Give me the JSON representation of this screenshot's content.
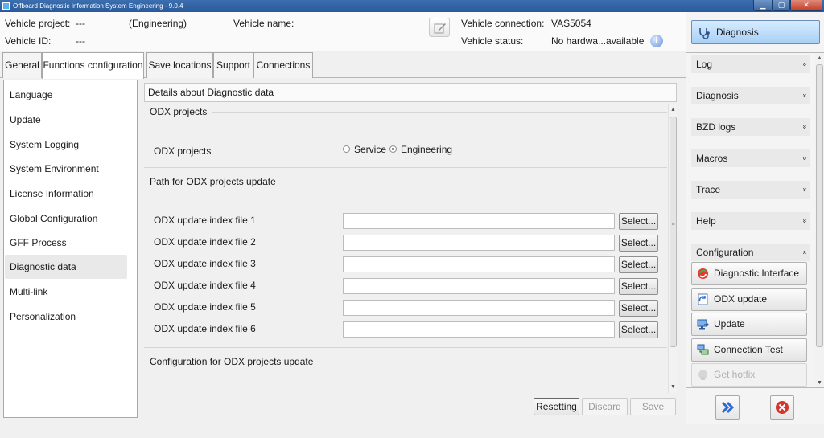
{
  "window": {
    "title": "Offboard Diagnostic Information System Engineering - 9.0.4",
    "min_glyph": "▁",
    "max_glyph": "▢",
    "close_glyph": "✕"
  },
  "header": {
    "vehicle_project_label": "Vehicle project:",
    "vehicle_project_value": "---",
    "project_type": "(Engineering)",
    "vehicle_name_label": "Vehicle name:",
    "vehicle_id_label": "Vehicle ID:",
    "vehicle_id_value": "---",
    "connection_label": "Vehicle connection:",
    "connection_value": "VAS5054",
    "status_label": "Vehicle status:",
    "status_value": "No hardwa...available",
    "info_glyph": "i"
  },
  "tabs": [
    "General",
    "Functions configuration",
    "Save locations",
    "Support",
    "Connections"
  ],
  "active_tab": "Functions configuration",
  "nav": {
    "items": [
      "Language",
      "Update",
      "System Logging",
      "System Environment",
      "License Information",
      "Global Configuration",
      "GFF Process",
      "Diagnostic data",
      "Multi-link",
      "Personalization"
    ],
    "selected": "Diagnostic data"
  },
  "content": {
    "caption": "Details about Diagnostic data",
    "odx_group_title": "ODX projects",
    "odx_field_label": "ODX projects",
    "radio_service": "Service",
    "radio_engineering": "Engineering",
    "radio_selected": "Engineering",
    "path_group_title": "Path for ODX projects update",
    "index_fields": [
      {
        "label": "ODX update index file 1",
        "value": ""
      },
      {
        "label": "ODX update index file 2",
        "value": ""
      },
      {
        "label": "ODX update index file 3",
        "value": ""
      },
      {
        "label": "ODX update index file 4",
        "value": ""
      },
      {
        "label": "ODX update index file 5",
        "value": ""
      },
      {
        "label": "ODX update index file 6",
        "value": ""
      }
    ],
    "select_label": "Select...",
    "config_group_title": "Configuration for ODX projects update",
    "scroll_up": "▲",
    "scroll_down": "▼"
  },
  "actions": {
    "resetting": "Resetting",
    "discard": "Discard",
    "save": "Save"
  },
  "right_panel": {
    "diagnosis_button": "Diagnosis",
    "sections": [
      {
        "label": "Log",
        "chevron": "»",
        "expanded": false
      },
      {
        "label": "Diagnosis",
        "chevron": "»",
        "expanded": false
      },
      {
        "label": "BZD logs",
        "chevron": "»",
        "expanded": false
      },
      {
        "label": "Macros",
        "chevron": "»",
        "expanded": false
      },
      {
        "label": "Trace",
        "chevron": "»",
        "expanded": false
      },
      {
        "label": "Help",
        "chevron": "»",
        "expanded": false
      },
      {
        "label": "Configuration",
        "chevron": "«",
        "expanded": true
      }
    ],
    "config_buttons": [
      {
        "label": "Diagnostic Interface",
        "icon": "diagnostic-interface-icon",
        "enabled": true
      },
      {
        "label": "ODX update",
        "icon": "odx-update-icon",
        "enabled": true
      },
      {
        "label": "Update",
        "icon": "update-icon",
        "enabled": true
      },
      {
        "label": "Connection Test",
        "icon": "connection-test-icon",
        "enabled": true
      },
      {
        "label": "Get hotfix",
        "icon": "get-hotfix-icon",
        "enabled": false
      }
    ],
    "scroll_up": "▲",
    "scroll_down": "▼"
  },
  "colors": {
    "titlebar": "#2a5a9a",
    "diagnosis_button": "#a9d0f5",
    "forward_icon": "#2d6bd0",
    "exit_icon": "#d9342b"
  }
}
